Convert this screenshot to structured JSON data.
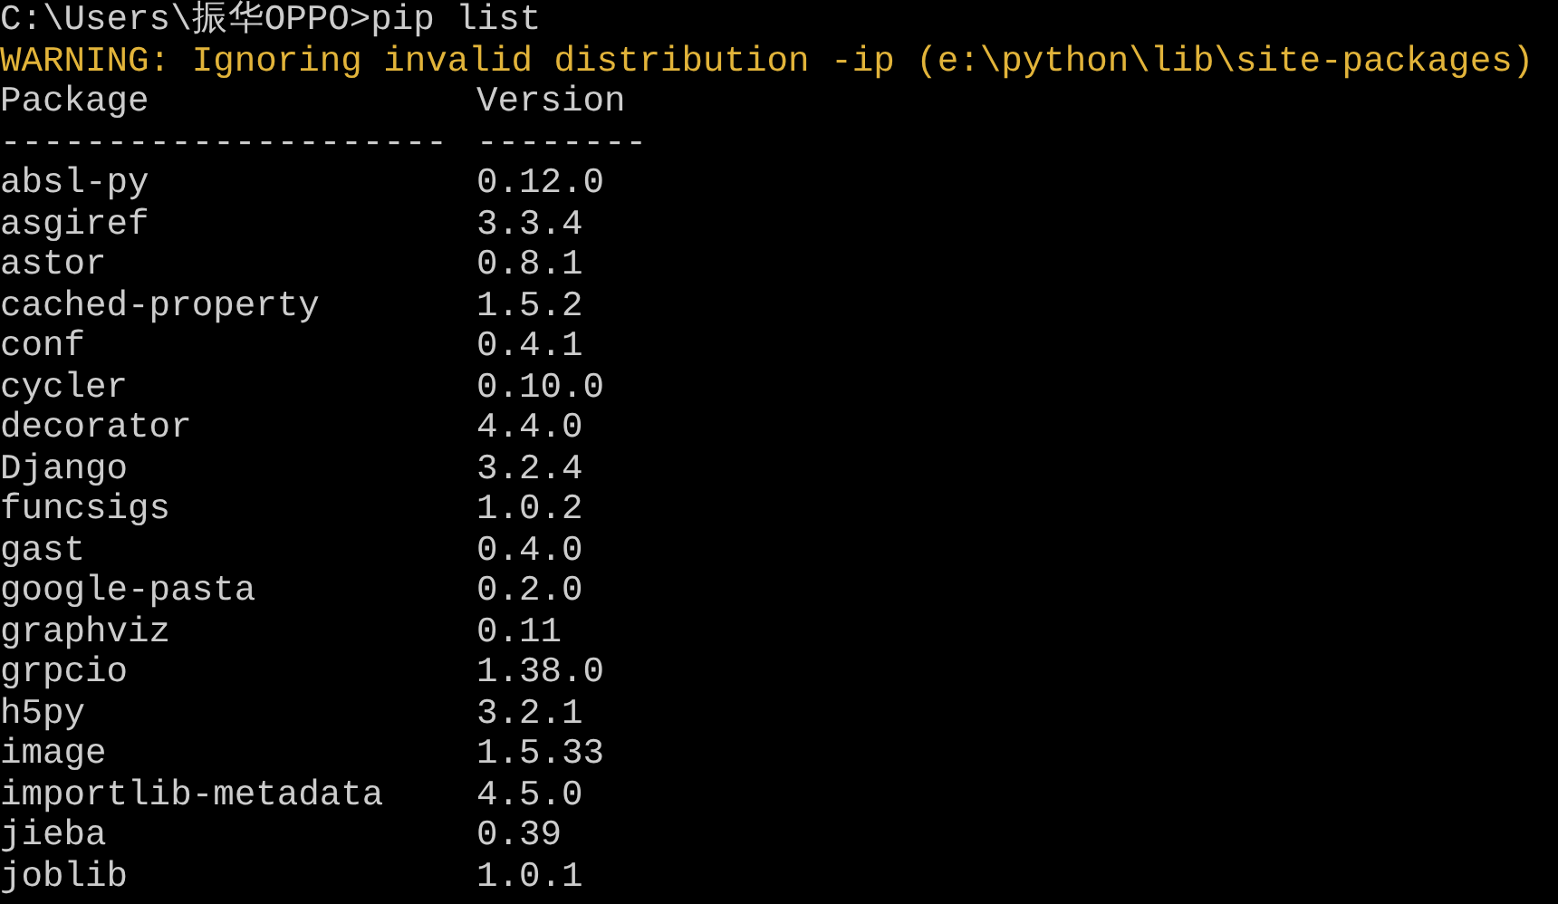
{
  "prompt_line": "C:\\Users\\振华OPPO>pip list",
  "warning": "WARNING: Ignoring invalid distribution -ip (e:\\python\\lib\\site-packages)",
  "columns": [
    {
      "header": "Package",
      "rule": "---------------------"
    },
    {
      "header": "Version",
      "rule": "--------"
    }
  ],
  "rows": [
    {
      "package": "absl-py",
      "version": "0.12.0"
    },
    {
      "package": "asgiref",
      "version": "3.3.4"
    },
    {
      "package": "astor",
      "version": "0.8.1"
    },
    {
      "package": "cached-property",
      "version": "1.5.2"
    },
    {
      "package": "conf",
      "version": "0.4.1"
    },
    {
      "package": "cycler",
      "version": "0.10.0"
    },
    {
      "package": "decorator",
      "version": "4.4.0"
    },
    {
      "package": "Django",
      "version": "3.2.4"
    },
    {
      "package": "funcsigs",
      "version": "1.0.2"
    },
    {
      "package": "gast",
      "version": "0.4.0"
    },
    {
      "package": "google-pasta",
      "version": "0.2.0"
    },
    {
      "package": "graphviz",
      "version": "0.11"
    },
    {
      "package": "grpcio",
      "version": "1.38.0"
    },
    {
      "package": "h5py",
      "version": "3.2.1"
    },
    {
      "package": "image",
      "version": "1.5.33"
    },
    {
      "package": "importlib-metadata",
      "version": "4.5.0"
    },
    {
      "package": "jieba",
      "version": "0.39"
    },
    {
      "package": "joblib",
      "version": "1.0.1"
    }
  ]
}
